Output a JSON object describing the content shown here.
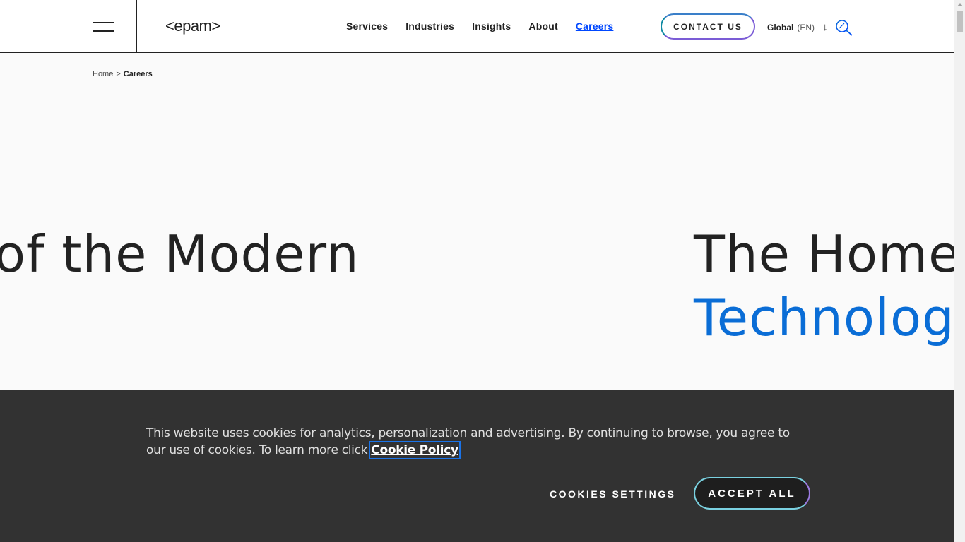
{
  "header": {
    "logo_text": "<epam>",
    "nav": [
      {
        "label": "Services",
        "active": false
      },
      {
        "label": "Industries",
        "active": false
      },
      {
        "label": "Insights",
        "active": false
      },
      {
        "label": "About",
        "active": false
      },
      {
        "label": "Careers",
        "active": true
      }
    ],
    "contact_label": "CONTACT US",
    "region_label": "Global",
    "language_label": "(EN)",
    "region_arrow": "↓",
    "accent_color": "#0047ff"
  },
  "breadcrumb": {
    "home": "Home",
    "separator": ">",
    "current": "Careers"
  },
  "hero": {
    "line_left": "of the Modern",
    "line_right_1": "The Home o",
    "line_right_2": "Technologi"
  },
  "cookie_banner": {
    "text": "This website uses cookies for analytics, personalization and advertising. By continuing to browse, you agree to our use of cookies. To learn more click",
    "link_label": "Cookie Policy",
    "settings_label": "COOKIES SETTINGS",
    "accept_label": "ACCEPT ALL"
  }
}
